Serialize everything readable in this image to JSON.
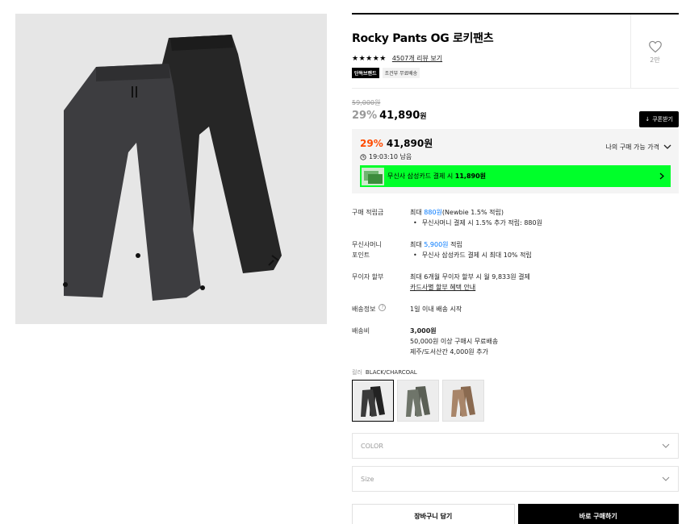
{
  "product": {
    "title": "Rocky Pants OG 로키팬츠",
    "stars": "★★★★★",
    "review_link": "4507개 리뷰 보기",
    "tag_exclusive": "단독브랜드",
    "tag_shipping": "조건부 무료배송",
    "like_count": "2만",
    "image_icon": "pants-photo"
  },
  "price": {
    "original": "59,000원",
    "discount": "29%",
    "current": "41,890",
    "unit": "원",
    "coupon_button": "쿠폰받기"
  },
  "promo": {
    "discount": "29%",
    "price": "41,890원",
    "my_price_label": "나의 구매 가능 가격",
    "timer": "19:03:10 남음",
    "card_text_pre": "무신사 삼성카드 결제 시",
    "card_text_price": "11,890원",
    "accent_color": "#00ff2a",
    "discount_color": "#ff4b00"
  },
  "details": {
    "points": {
      "label": "구매 적립금",
      "pre": "최대",
      "amount": "880원",
      "post": "(Newbie 1.5% 적립)",
      "bullet": "무신사머니 결제 시 1.5% 추가 적립: 880원"
    },
    "money_points": {
      "label_line1": "무신사머니",
      "label_line2": "포인트",
      "pre": "최대",
      "amount": "5,900원",
      "post": "적립",
      "bullet": "무신사 삼성카드 결제 시 최대 10% 적립"
    },
    "installment": {
      "label": "무이자 할부",
      "line1": "최대 6개월 무이자 할부 시 월 9,833원 결제",
      "line2": "카드사별 할부 혜택 안내"
    },
    "shipping_info": {
      "label": "배송정보",
      "value": "1일 이내 배송 시작"
    },
    "shipping_fee": {
      "label": "배송비",
      "amount": "3,000원",
      "line2": "50,000원 이상 구매시 무료배송",
      "line3": "제주/도서산간 4,000원 추가"
    }
  },
  "color": {
    "label": "컬러",
    "selected": "BLACK/CHARCOAL"
  },
  "options": {
    "color_placeholder": "COLOR",
    "size_placeholder": "Size"
  },
  "actions": {
    "cart": "장바구니 담기",
    "buy": "바로 구매하기"
  }
}
